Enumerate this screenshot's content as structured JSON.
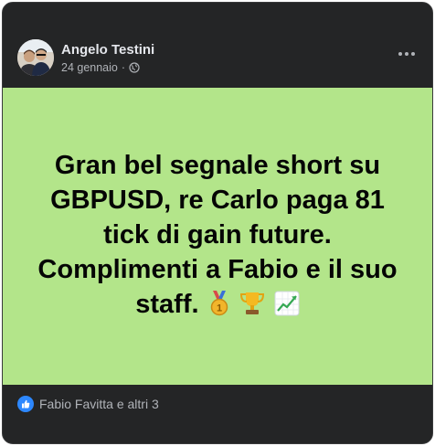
{
  "post": {
    "author": "Angelo Testini",
    "date": "24 gennaio",
    "date_separator": "·",
    "privacy_icon": "globe-icon",
    "more_icon": "more-options-icon",
    "text": "Gran bel segnale short su GBPUSD, re Carlo paga 81 tick di gain future. Complimenti a Fabio e il suo staff.",
    "emojis": [
      "medal-icon",
      "trophy-icon",
      "chart-increasing-icon"
    ],
    "background_color": "#b3e58a",
    "reactions": {
      "icon": "like-icon",
      "text": "Fabio Favitta e altri 3"
    }
  }
}
